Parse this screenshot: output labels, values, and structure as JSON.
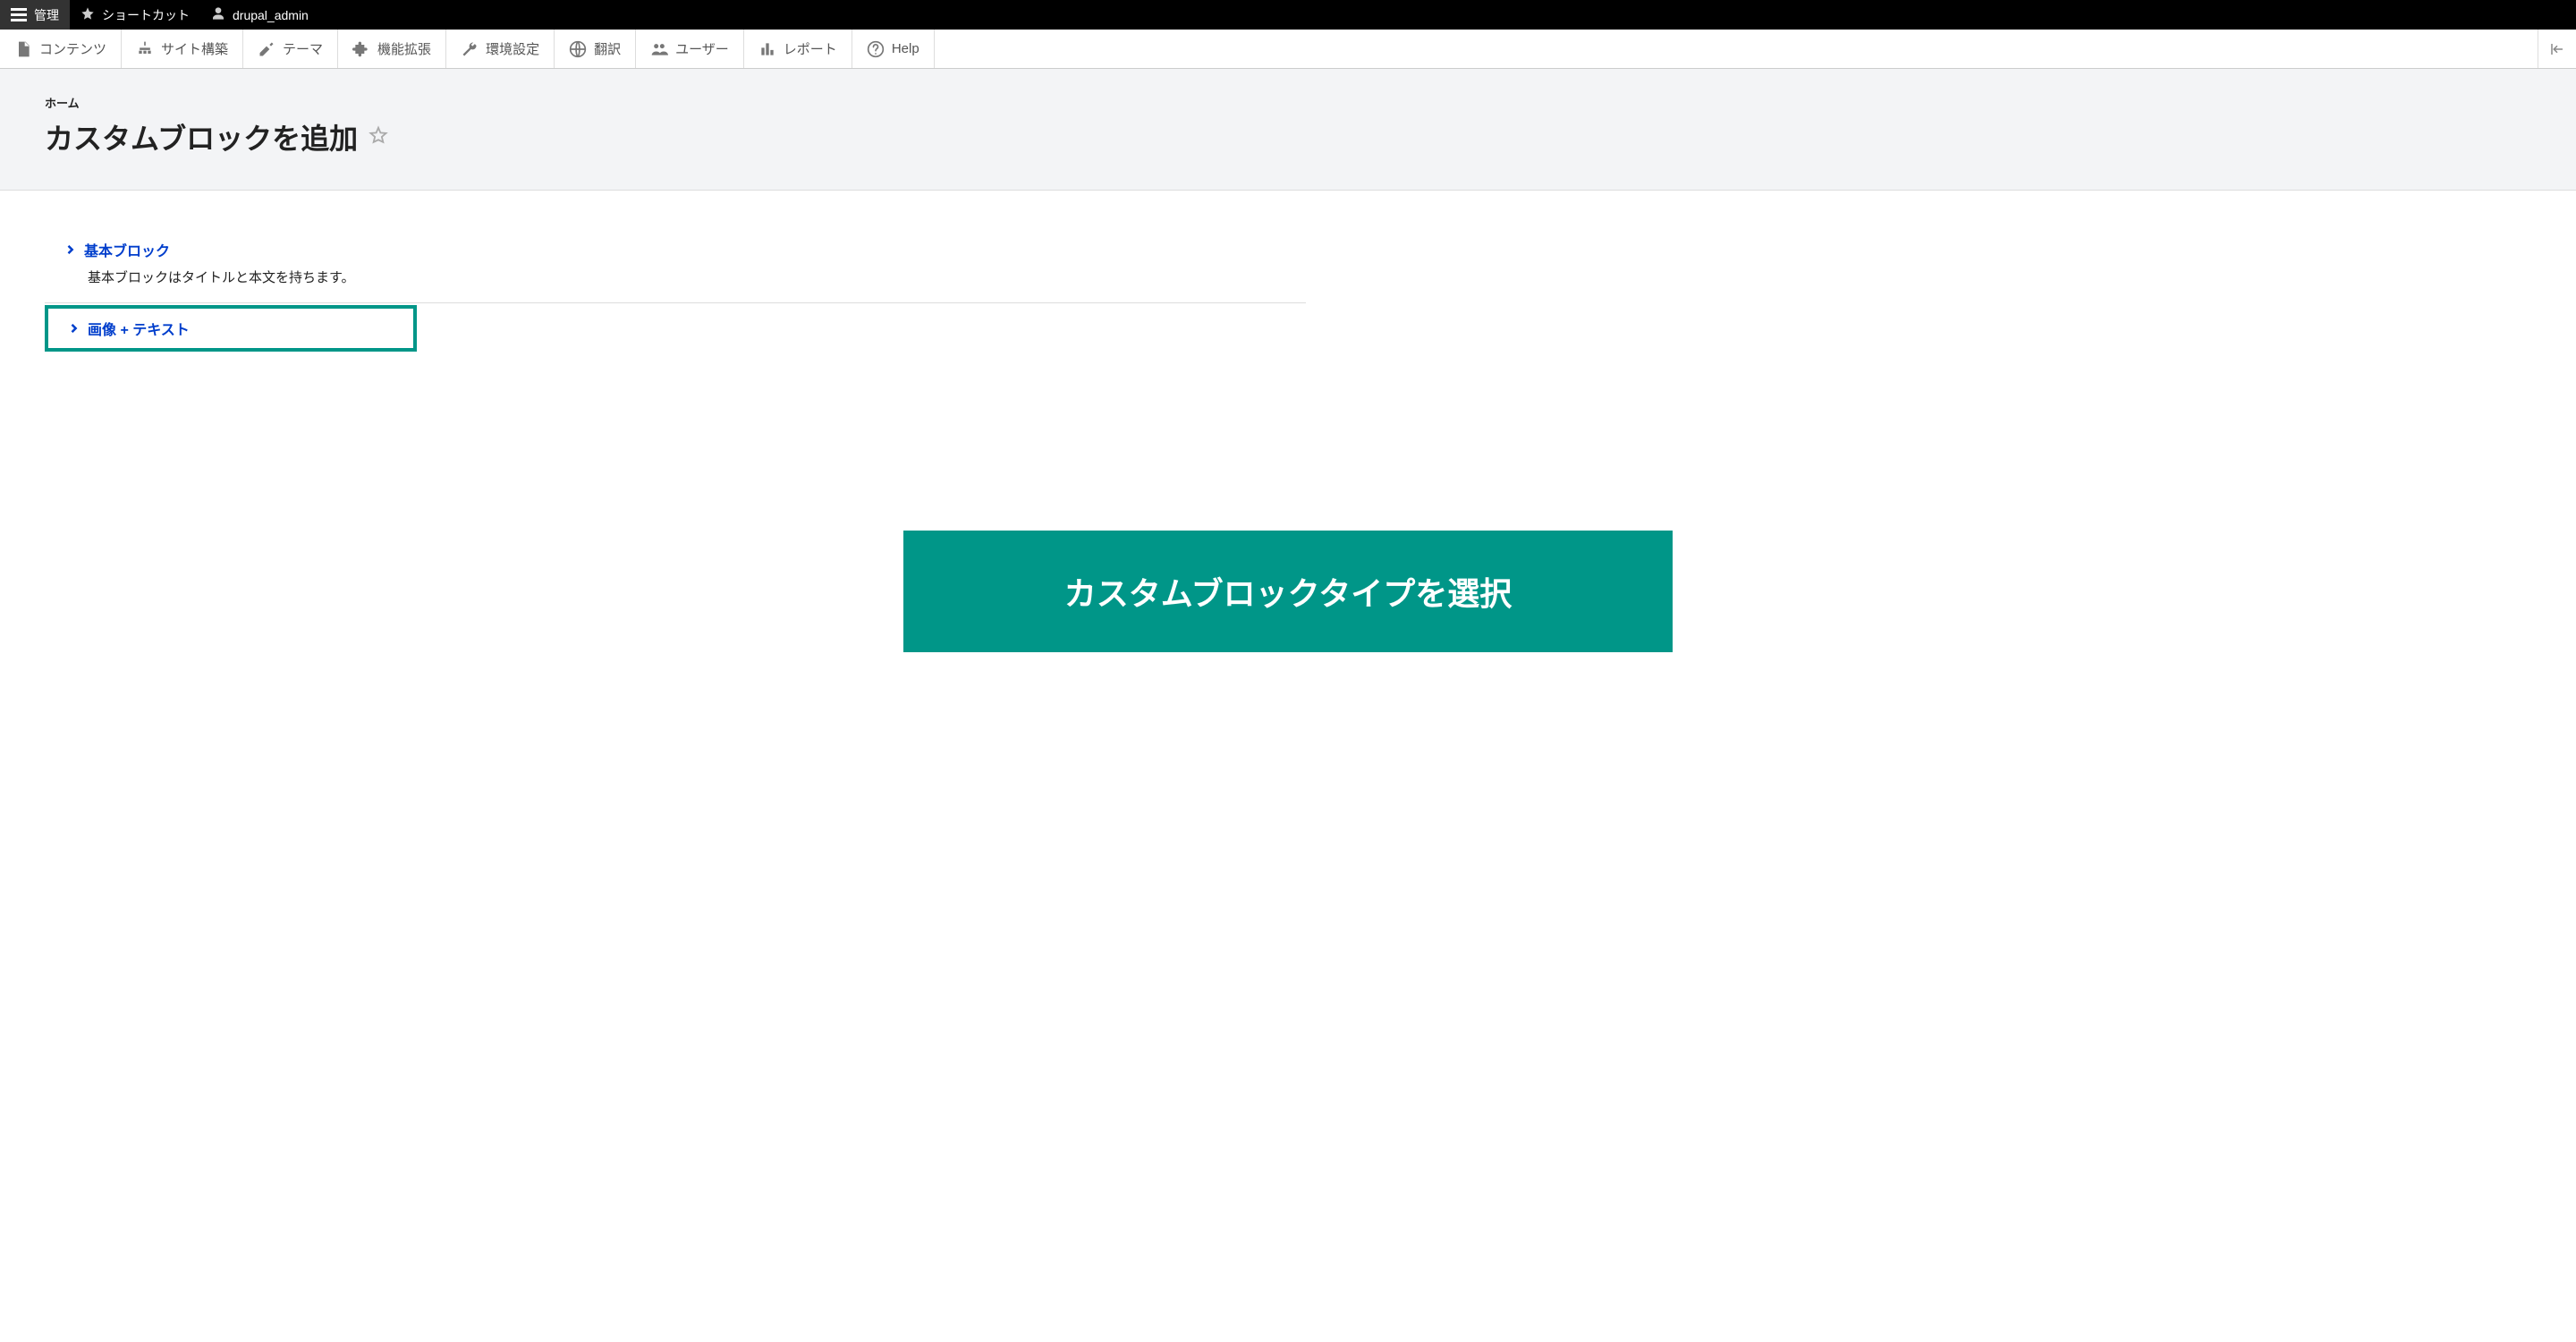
{
  "topbar": {
    "manage": "管理",
    "shortcuts": "ショートカット",
    "username": "drupal_admin"
  },
  "adminbar": {
    "items": [
      {
        "label": "コンテンツ",
        "icon": "file"
      },
      {
        "label": "サイト構築",
        "icon": "structure"
      },
      {
        "label": "テーマ",
        "icon": "paint"
      },
      {
        "label": "機能拡張",
        "icon": "puzzle"
      },
      {
        "label": "環境設定",
        "icon": "wrench"
      },
      {
        "label": "翻訳",
        "icon": "globe"
      },
      {
        "label": "ユーザー",
        "icon": "users"
      },
      {
        "label": "レポート",
        "icon": "chart"
      },
      {
        "label": "Help",
        "icon": "help"
      }
    ]
  },
  "header": {
    "breadcrumb": "ホーム",
    "title": "カスタムブロックを追加"
  },
  "blocks": [
    {
      "title": "基本ブロック",
      "desc": "基本ブロックはタイトルと本文を持ちます。",
      "highlighted": false
    },
    {
      "title": "画像 + テキスト",
      "desc": "",
      "highlighted": true
    }
  ],
  "banner": "カスタムブロックタイプを選択"
}
